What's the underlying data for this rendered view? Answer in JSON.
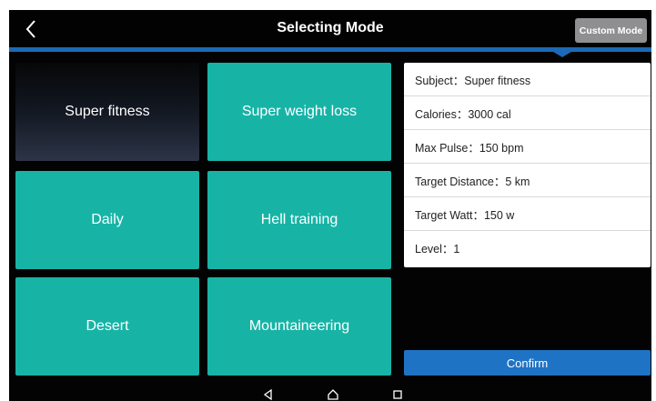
{
  "header": {
    "title": "Selecting Mode",
    "custom_mode_label": "Custom Mode"
  },
  "modes": [
    {
      "label": "Super fitness",
      "selected": true
    },
    {
      "label": "Super weight loss",
      "selected": false
    },
    {
      "label": "Daily",
      "selected": false
    },
    {
      "label": "Hell training",
      "selected": false
    },
    {
      "label": "Desert",
      "selected": false
    },
    {
      "label": "Mountaineering",
      "selected": false
    }
  ],
  "details": [
    {
      "label": "Subject",
      "value": "Super fitness",
      "text": "Subject：Super fitness"
    },
    {
      "label": "Calories",
      "value": "3000 cal",
      "text": "Calories：3000 cal"
    },
    {
      "label": "Max Pulse",
      "value": "150 bpm",
      "text": "Max Pulse：150 bpm"
    },
    {
      "label": "Target Distance",
      "value": "5 km",
      "text": "Target Distance：5 km"
    },
    {
      "label": "Target Watt",
      "value": "150 w",
      "text": "Target Watt：150 w"
    },
    {
      "label": "Level",
      "value": "1",
      "text": "Level：1"
    }
  ],
  "confirm_label": "Confirm",
  "icons": {
    "back": "chevron-left-icon",
    "nav_back": "triangle-back-icon",
    "nav_home": "home-icon",
    "nav_recents": "square-recents-icon"
  },
  "colors": {
    "tile": "#17b4a6",
    "accent_blue": "#1c69b5",
    "confirm": "#1f73c5",
    "custom_button": "#8f8f92"
  }
}
